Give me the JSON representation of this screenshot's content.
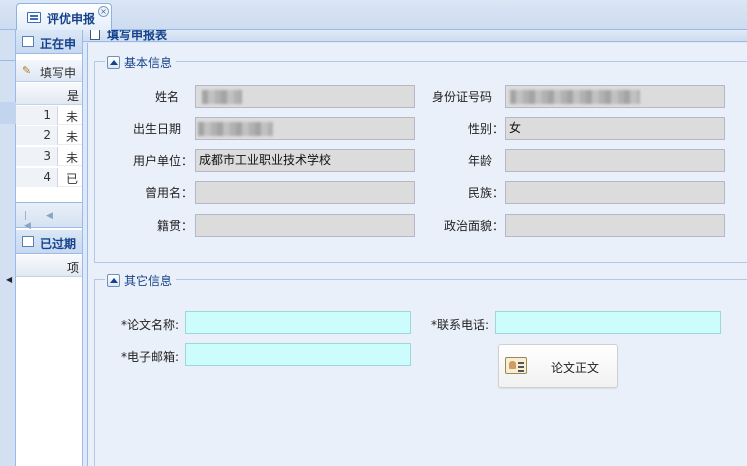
{
  "tab": {
    "title": "评优申报",
    "close": "×"
  },
  "left": {
    "panel_active": "正在申",
    "fill_action": "填写申",
    "col_header": "是",
    "rows": [
      {
        "num": "1",
        "val": "未"
      },
      {
        "num": "2",
        "val": "未"
      },
      {
        "num": "3",
        "val": "未"
      },
      {
        "num": "4",
        "val": "已"
      }
    ],
    "panel_expired": "已过期",
    "col_header2": "项"
  },
  "form": {
    "title": "填写申报表",
    "basic": {
      "legend": "基本信息",
      "name_label": "姓名",
      "idcard_label": "身份证号码",
      "birth_label": "出生日期",
      "gender_label": "性别：",
      "gender_value": "女",
      "unit_label": "用户单位：",
      "unit_value": "成都市工业职业技术学校",
      "age_label": "年龄",
      "former_name_label": "曾用名：",
      "ethnic_label": "民族：",
      "native_label": "籍贯：",
      "political_label": "政治面貌："
    },
    "other": {
      "legend": "其它信息",
      "paper_label": "*论文名称:",
      "phone_label": "*联系电话:",
      "email_label": "*电子邮箱:",
      "doc_button": "论文正文"
    }
  }
}
